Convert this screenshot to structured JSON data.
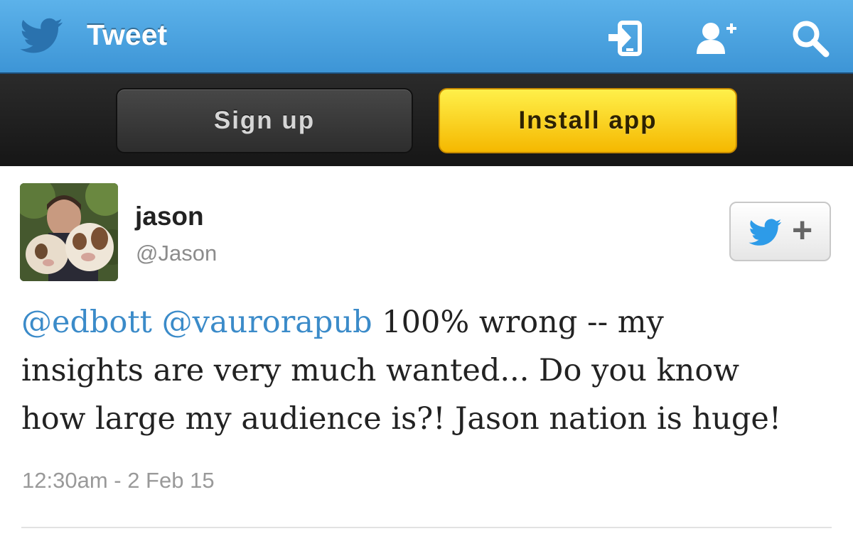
{
  "header": {
    "title": "Tweet",
    "logo_icon": "twitter-bird-icon",
    "icons": [
      "sign-in-icon",
      "follow-user-icon",
      "search-icon"
    ],
    "background_color": "#4aa3e0"
  },
  "actions": {
    "signup_label": "Sign up",
    "install_label": "Install app",
    "install_color": "#f7c51c"
  },
  "tweet": {
    "display_name": "jason",
    "screen_name": "@Jason",
    "follow_button_plus": "+",
    "follow_icon": "twitter-bird-icon",
    "text": {
      "mention_1": "@edbott",
      "mention_2": "@vaurorapub",
      "line_1": " 100% wrong -- my",
      "line_2": "insights are very much wanted... Do you know",
      "line_3": "how large my audience is?! Jason nation is huge!"
    },
    "timestamp": "12:30am - 2 Feb 15",
    "mention_color": "#3b8bc9"
  }
}
